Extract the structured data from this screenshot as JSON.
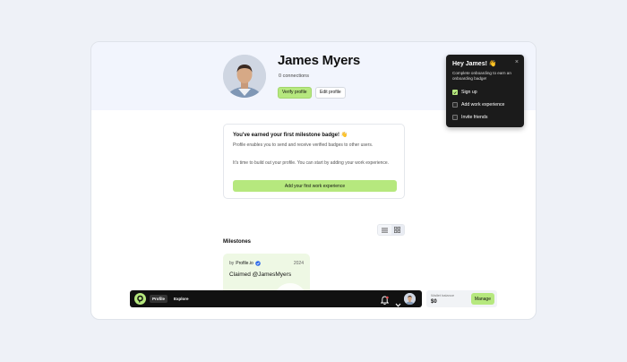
{
  "profile": {
    "name": "James Myers",
    "connections": "0 connections",
    "verify_label": "Verify profile",
    "edit_label": "Edit profile"
  },
  "milestone_card": {
    "title": "You've earned your first milestone badge! 👋",
    "p1": "Profile enables you to send and receive verified badges to other users.",
    "p2": "It's time to build out your profile. You can start by adding your work experience.",
    "button": "Add your first work experience"
  },
  "milestones": {
    "title": "Milestones",
    "badges": [
      {
        "by_prefix": "by",
        "issuer": "Profile.io",
        "year": "2024",
        "title": "Claimed @JamesMyers"
      }
    ]
  },
  "taskbar": {
    "items": [
      {
        "label": "Profile",
        "active": true
      },
      {
        "label": "Explore",
        "active": false
      }
    ]
  },
  "wallet": {
    "label": "Wallet balance",
    "value": "$0",
    "button": "Manage"
  },
  "onboarding": {
    "title": "Hey James! 👋",
    "close": "×",
    "description": "Complete onboarding to earn an onboarding badge!",
    "tasks": [
      {
        "label": "Sign up",
        "done": true
      },
      {
        "label": "Add work experience",
        "done": false
      },
      {
        "label": "Invite friends",
        "done": false
      }
    ]
  },
  "colors": {
    "accent": "#b6e87e",
    "hero_band": "#f2f5fd",
    "taskbar": "#111111",
    "popover": "#1b1b1b"
  },
  "icons": {
    "logo": "profile-logo-icon",
    "notification": "bell-icon",
    "menu": "chevron-down-icon",
    "verified": "verified-check-icon",
    "list_view": "list-icon",
    "grid_view": "grid-icon"
  }
}
